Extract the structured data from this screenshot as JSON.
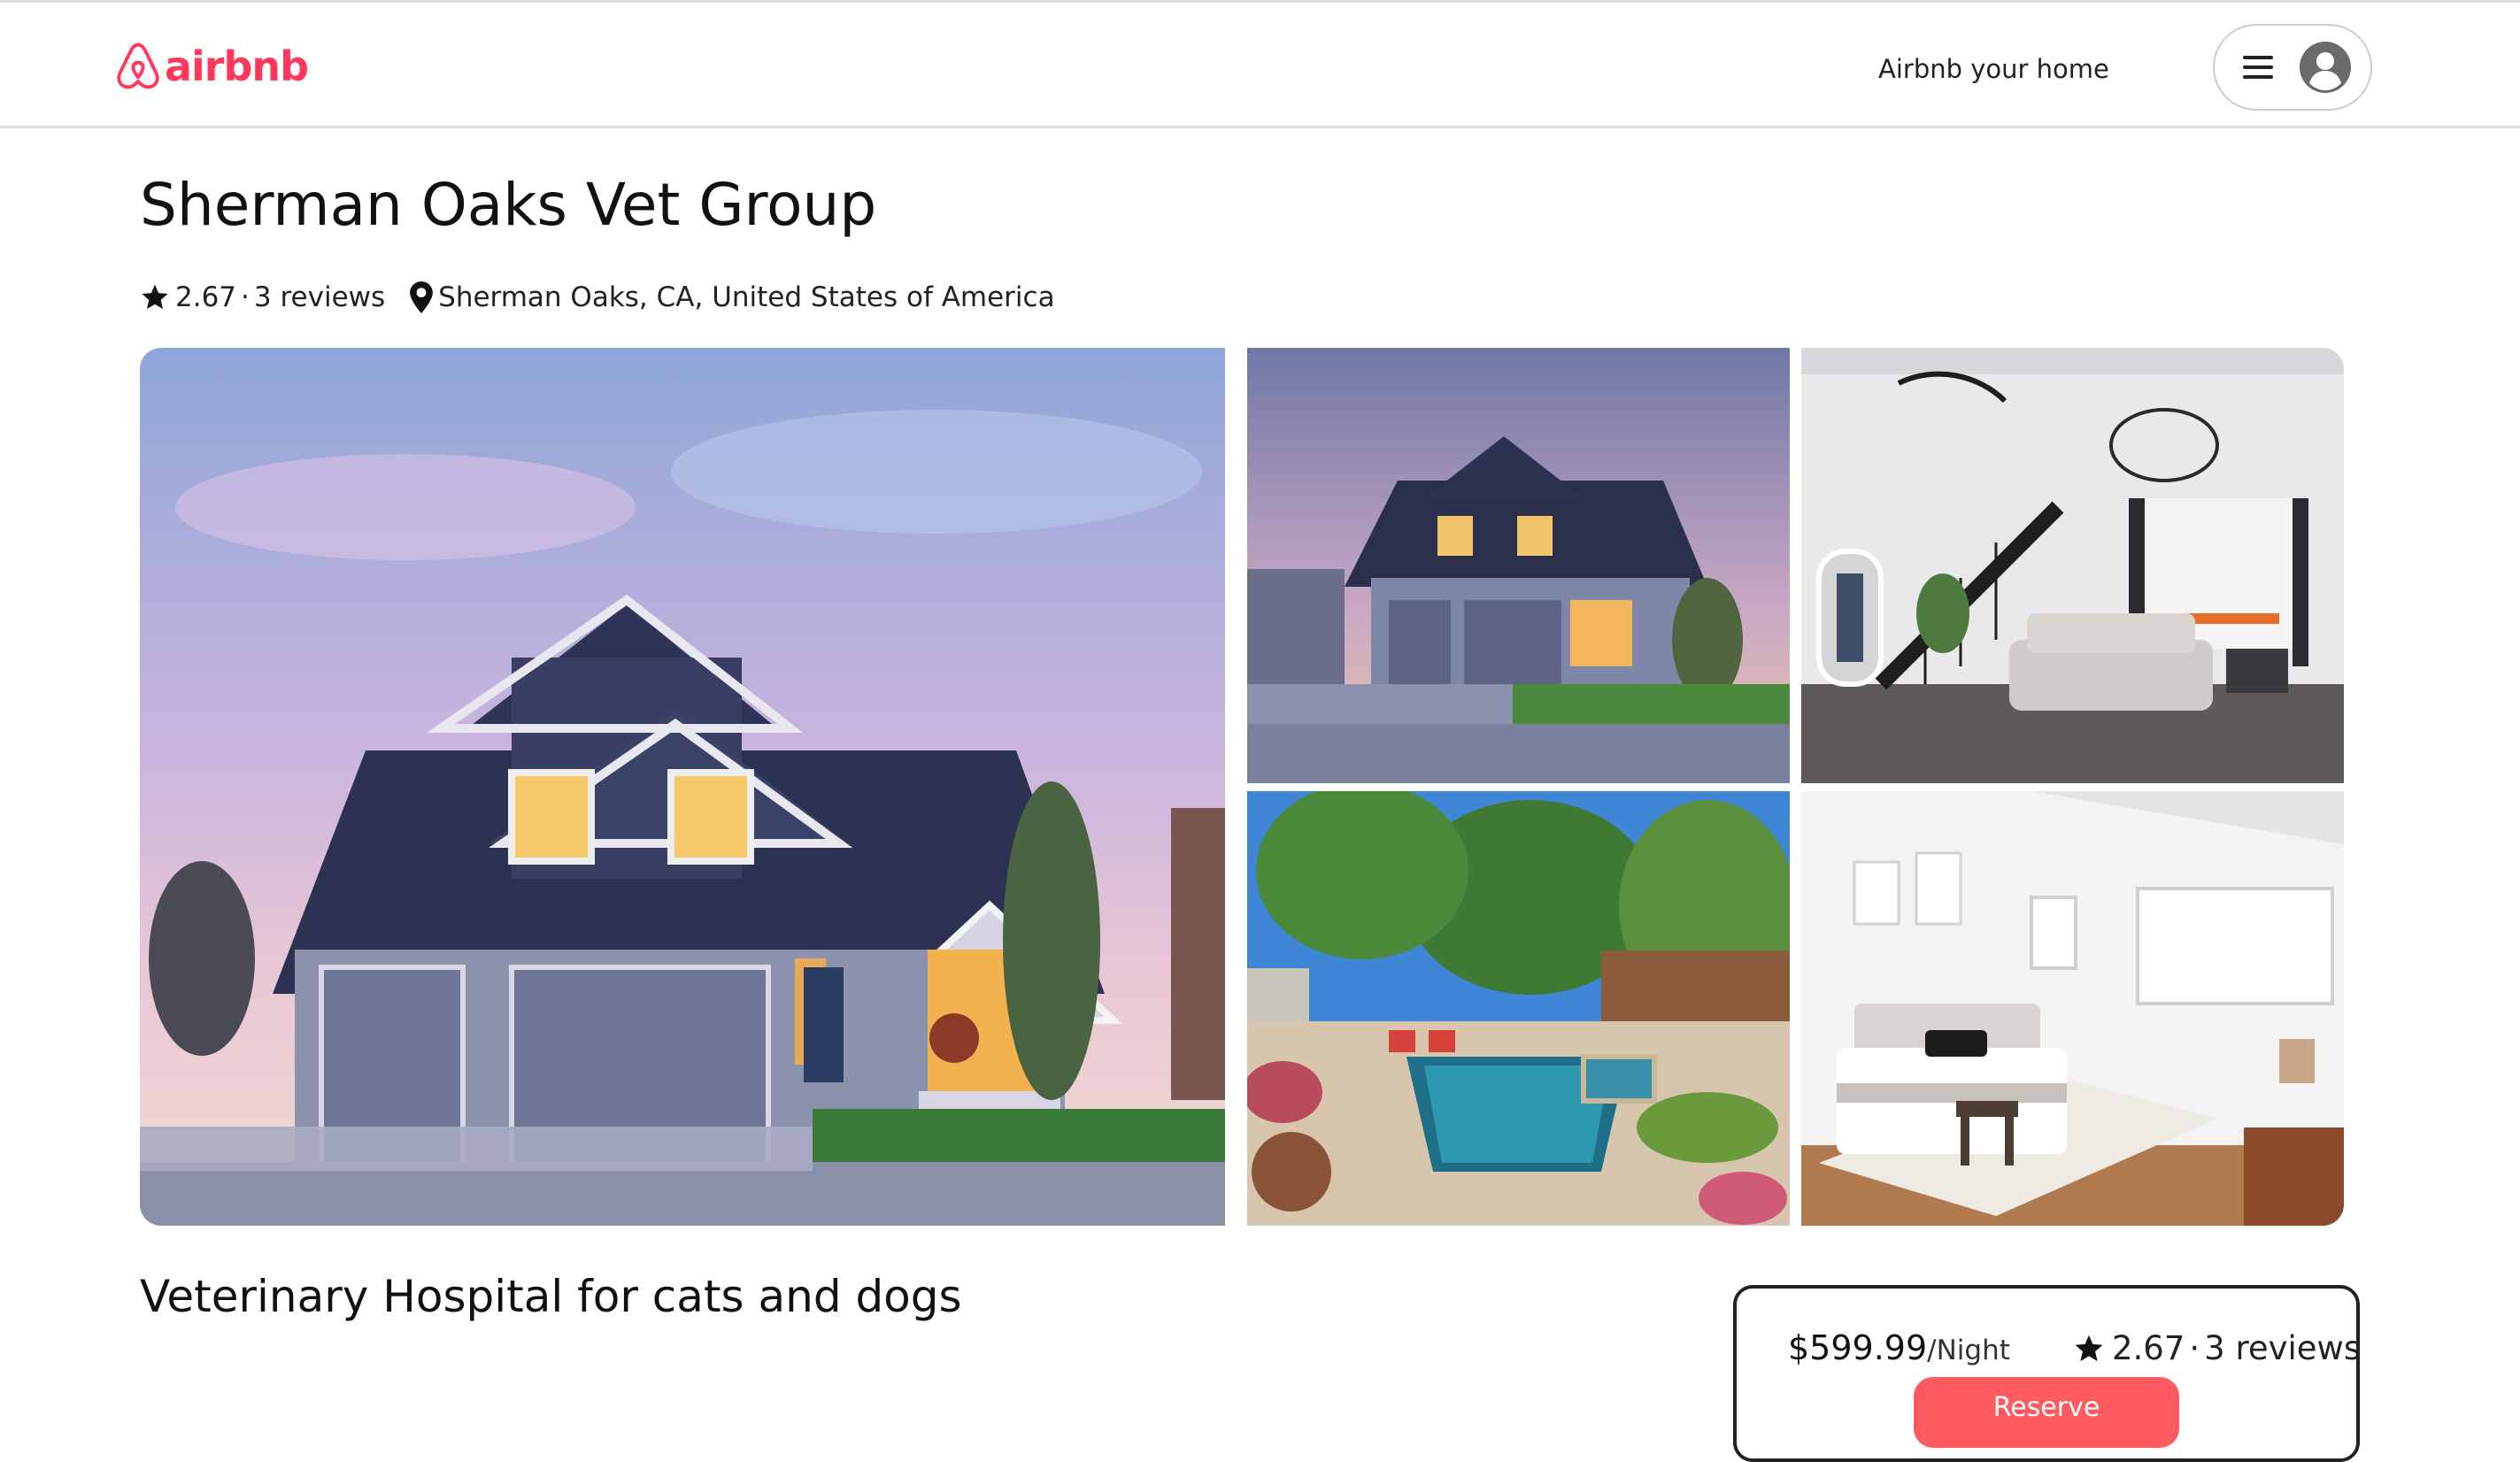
{
  "header": {
    "logo_text": "airbnb",
    "host_link": "Airbnb your home",
    "menu_icon": "hamburger-menu-icon",
    "avatar_icon": "user-avatar-icon"
  },
  "listing": {
    "title": "Sherman Oaks Vet Group",
    "rating": "2.67",
    "separator": "·",
    "reviews": "3 reviews",
    "location": "Sherman Oaks, CA, United States of America",
    "subtitle": "Veterinary Hospital for cats and dogs"
  },
  "gallery": {
    "photos": [
      "house-exterior-dusk",
      "house-exterior-front",
      "living-room-staircase",
      "backyard-pool",
      "bedroom"
    ]
  },
  "booking": {
    "price": "$599.99",
    "unit": "/Night",
    "rating": "2.67",
    "separator": "·",
    "reviews": "3 reviews",
    "reserve_label": "Reserve"
  },
  "colors": {
    "brand": "#ff385c",
    "reserve_button": "#ff5a5f",
    "text": "#222222"
  }
}
